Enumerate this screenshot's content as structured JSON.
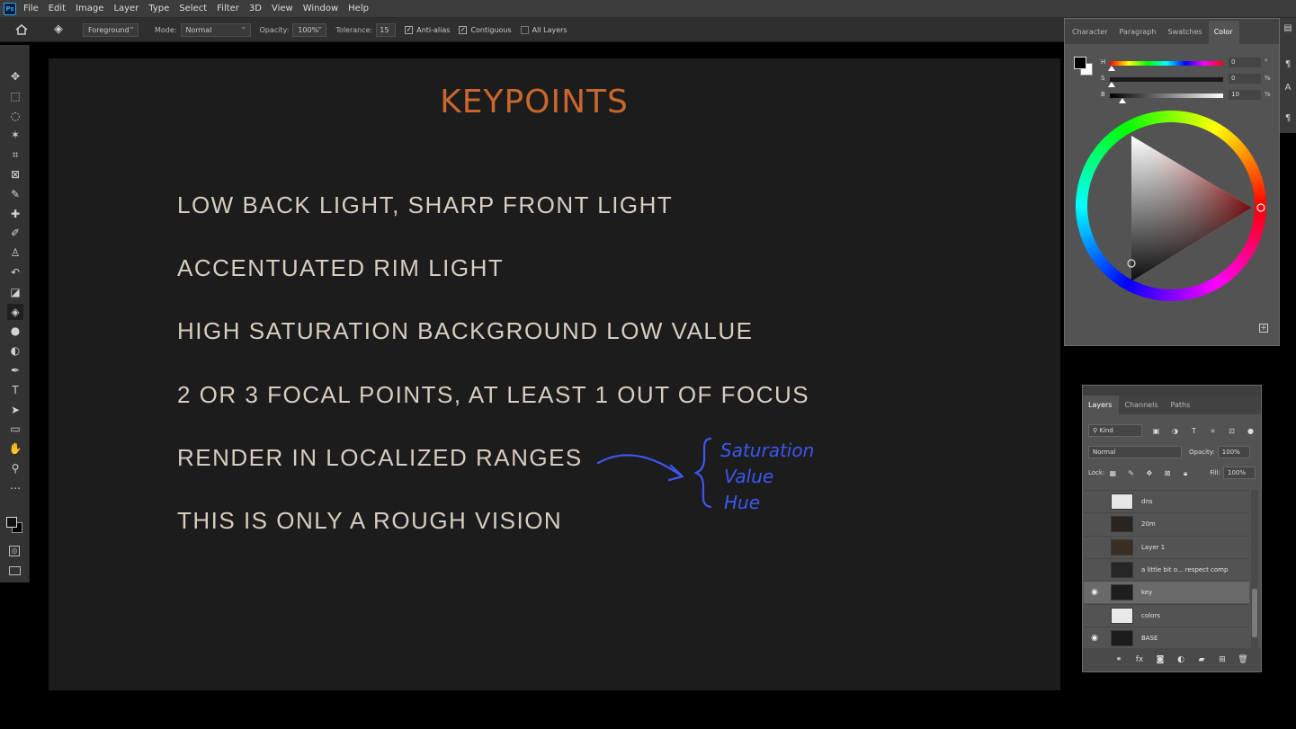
{
  "app": {
    "logo_text": "Ps"
  },
  "menu": [
    "File",
    "Edit",
    "Image",
    "Layer",
    "Type",
    "Select",
    "Filter",
    "3D",
    "View",
    "Window",
    "Help"
  ],
  "options": {
    "tool_icon": "paint-bucket-icon",
    "fill_source": "Foreground",
    "mode_label": "Mode:",
    "mode_value": "Normal",
    "opacity_label": "Opacity:",
    "opacity_value": "100%",
    "tolerance_label": "Tolerance:",
    "tolerance_value": "15",
    "antialias_label": "Anti-alias",
    "antialias_checked": true,
    "contiguous_label": "Contiguous",
    "contiguous_checked": true,
    "all_layers_label": "All Layers",
    "all_layers_checked": false
  },
  "tools": [
    {
      "name": "move",
      "glyph": "✥"
    },
    {
      "name": "marquee",
      "glyph": "⬚"
    },
    {
      "name": "lasso",
      "glyph": "◌"
    },
    {
      "name": "magic-wand",
      "glyph": "✶"
    },
    {
      "name": "crop",
      "glyph": "⌗"
    },
    {
      "name": "frame",
      "glyph": "⊠"
    },
    {
      "name": "eyedropper",
      "glyph": "✎"
    },
    {
      "name": "healing",
      "glyph": "✚"
    },
    {
      "name": "brush",
      "glyph": "✐"
    },
    {
      "name": "stamp",
      "glyph": "♙"
    },
    {
      "name": "history-brush",
      "glyph": "↶"
    },
    {
      "name": "eraser",
      "glyph": "◪"
    },
    {
      "name": "paint-bucket",
      "glyph": "◈"
    },
    {
      "name": "blur",
      "glyph": "●"
    },
    {
      "name": "dodge",
      "glyph": "◐"
    },
    {
      "name": "pen",
      "glyph": "✒"
    },
    {
      "name": "type",
      "glyph": "T"
    },
    {
      "name": "path-selection",
      "glyph": "➤"
    },
    {
      "name": "rectangle",
      "glyph": "▭"
    },
    {
      "name": "hand",
      "glyph": "✋"
    },
    {
      "name": "zoom",
      "glyph": "⚲"
    },
    {
      "name": "more",
      "glyph": "⋯"
    }
  ],
  "document": {
    "title": "KEYPOINTS",
    "lines": [
      "LOW BACK LIGHT, SHARP FRONT LIGHT",
      "ACCENTUATED RIM LIGHT",
      "HIGH SATURATION BACKGROUND LOW VALUE",
      "2 OR 3 FOCAL POINTS, AT LEAST 1 OUT OF FOCUS",
      "RENDER IN LOCALIZED RANGES",
      "THIS IS ONLY A ROUGH VISION"
    ],
    "annotation": [
      "Saturation",
      "Value",
      "Hue"
    ],
    "title_color": "#c8672d",
    "annotation_color": "#3d57f0"
  },
  "color_panel": {
    "tabs": [
      "Character",
      "Paragraph",
      "Swatches",
      "Color"
    ],
    "active_tab": "Color",
    "h": {
      "label": "H",
      "value": "0",
      "unit": "°"
    },
    "s": {
      "label": "S",
      "value": "0",
      "unit": "%"
    },
    "b": {
      "label": "B",
      "value": "10",
      "unit": "%"
    },
    "foreground": "#1a1a1a",
    "background": "#ffffff"
  },
  "layers_panel": {
    "tabs": [
      "Layers",
      "Channels",
      "Paths"
    ],
    "active_tab": "Layers",
    "filter_label": "Kind",
    "blend_mode": "Normal",
    "opacity_label": "Opacity:",
    "opacity_value": "100%",
    "lock_label": "Lock:",
    "fill_label": "Fill:",
    "fill_value": "100%",
    "layers": [
      {
        "name": "dns",
        "visible": false,
        "thumb": "#e6e6e6"
      },
      {
        "name": "20m",
        "visible": false,
        "thumb": "#2a2420"
      },
      {
        "name": "Layer 1",
        "visible": false,
        "thumb": "#3a2e22"
      },
      {
        "name": "a little bit o... respect comp",
        "visible": false,
        "thumb": "#262626"
      },
      {
        "name": "key",
        "visible": true,
        "thumb": "#1e1e1e",
        "selected": true
      },
      {
        "name": "colors",
        "visible": false,
        "thumb": "#e8e8e8"
      },
      {
        "name": "BASE",
        "visible": true,
        "thumb": "#1c1c1c"
      }
    ]
  }
}
